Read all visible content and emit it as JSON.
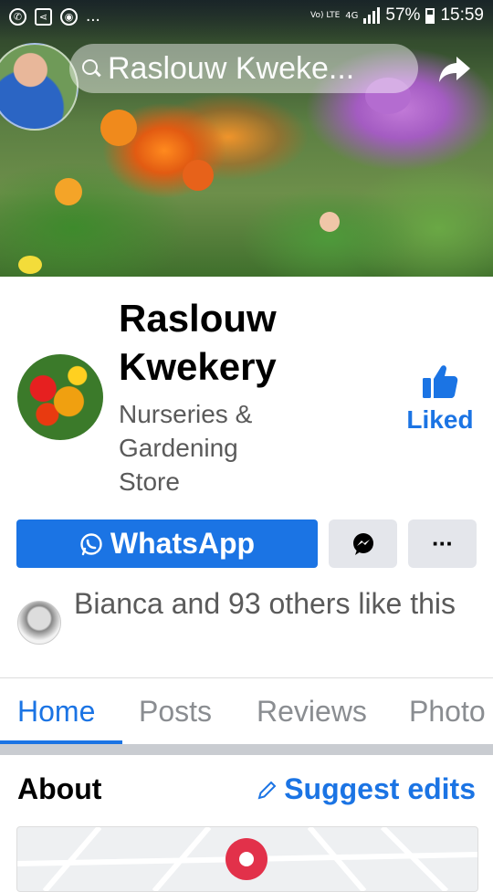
{
  "status_bar": {
    "battery": "57%",
    "time": "15:59",
    "network": "4G",
    "volte": "Vo) LTE",
    "more": "..."
  },
  "search": {
    "query": "Raslouw Kweke..."
  },
  "page": {
    "name": "Raslouw Kwekery",
    "category": "Nurseries & Gardening Store",
    "liked_label": "Liked"
  },
  "actions": {
    "whatsapp_label": "WhatsApp",
    "more_label": "···"
  },
  "likes": {
    "text": "Bianca and 93 others like this"
  },
  "tabs": [
    {
      "label": "Home"
    },
    {
      "label": "Posts"
    },
    {
      "label": "Reviews"
    },
    {
      "label": "Photo"
    }
  ],
  "about": {
    "title": "About",
    "suggest_label": "Suggest edits"
  },
  "colors": {
    "accent": "#1b74e4",
    "button_grey": "#e4e6eb",
    "pin": "#e2314a"
  },
  "icons": [
    "whatsapp-icon",
    "messenger-icon",
    "thumbs-up-icon",
    "share-icon",
    "search-icon",
    "pencil-icon",
    "map-pin-icon"
  ]
}
